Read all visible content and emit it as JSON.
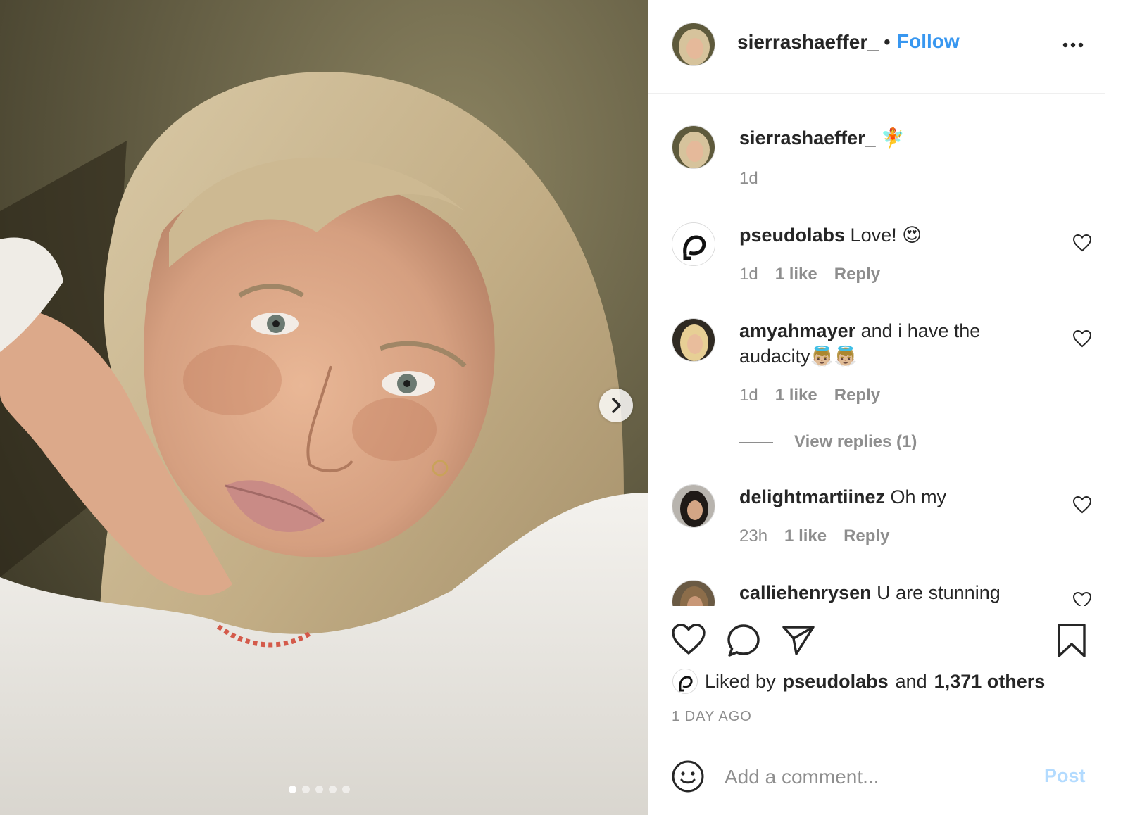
{
  "post": {
    "author": "sierrashaeffer_",
    "separator": "•",
    "follow_label": "Follow",
    "more_icon": "more-options-icon",
    "carousel": {
      "slide_count": 5,
      "active_index": 0,
      "next_icon": "chevron-right-icon"
    }
  },
  "caption": {
    "username": "sierrashaeffer_",
    "text": "🧚",
    "time": "1d"
  },
  "comments": [
    {
      "username": "pseudolabs",
      "text": "Love! 😍",
      "time": "1d",
      "likes": "1 like",
      "reply": "Reply"
    },
    {
      "username": "amyahmayer",
      "text": "and i have the audacity👼🏼👼🏼",
      "time": "1d",
      "likes": "1 like",
      "reply": "Reply",
      "view_replies": "View replies (1)"
    },
    {
      "username": "delightmartiinez",
      "text": "Oh my",
      "time": "23h",
      "likes": "1 like",
      "reply": "Reply"
    },
    {
      "username": "calliehenrysen",
      "text": "U are stunning"
    }
  ],
  "actions": {
    "like_icon": "heart-icon",
    "comment_icon": "comment-icon",
    "share_icon": "send-icon",
    "save_icon": "bookmark-icon",
    "liked_by_prefix": "Liked by",
    "liked_by_user": "pseudolabs",
    "liked_by_and": "and",
    "liked_by_others": "1,371 others",
    "timestamp": "1 DAY AGO"
  },
  "composer": {
    "placeholder": "Add a comment...",
    "post_label": "Post",
    "emoji_icon": "emoji-icon"
  },
  "colors": {
    "accent": "#3897f0",
    "post_disabled": "#b3dbff",
    "muted": "#8e8e8e",
    "text": "#262626"
  }
}
